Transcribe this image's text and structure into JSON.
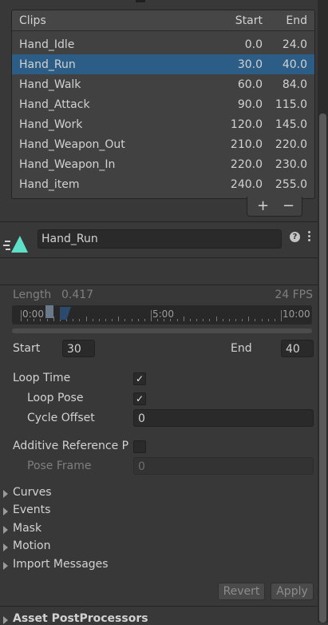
{
  "clips": {
    "header": {
      "name": "Clips",
      "start": "Start",
      "end": "End"
    },
    "rows": [
      {
        "name": "Hand_Idle",
        "start": "0.0",
        "end": "24.0"
      },
      {
        "name": "Hand_Run",
        "start": "30.0",
        "end": "40.0"
      },
      {
        "name": "Hand_Walk",
        "start": "60.0",
        "end": "84.0"
      },
      {
        "name": "Hand_Attack",
        "start": "90.0",
        "end": "115.0"
      },
      {
        "name": "Hand_Work",
        "start": "120.0",
        "end": "145.0"
      },
      {
        "name": "Hand_Weapon_Out",
        "start": "210.0",
        "end": "220.0"
      },
      {
        "name": "Hand_Weapon_In",
        "start": "220.0",
        "end": "230.0"
      },
      {
        "name": "Hand_item",
        "start": "240.0",
        "end": "255.0"
      }
    ],
    "selected_index": 1,
    "add_label": "+",
    "remove_label": "−"
  },
  "clip": {
    "name": "Hand_Run",
    "help_label": "?",
    "icon": "animation-clip-icon",
    "length_label": "Length",
    "length_value": "0.417",
    "fps": "24 FPS"
  },
  "timeline": {
    "labels": [
      "0:00",
      "5:00",
      "10:00"
    ]
  },
  "range": {
    "start_label": "Start",
    "start_value": "30",
    "end_label": "End",
    "end_value": "40"
  },
  "settings": {
    "loop_time_label": "Loop Time",
    "loop_time_checked": true,
    "loop_pose_label": "Loop Pose",
    "loop_pose_checked": true,
    "cycle_offset_label": "Cycle Offset",
    "cycle_offset_value": "0",
    "additive_label": "Additive Reference P",
    "additive_checked": false,
    "pose_frame_label": "Pose Frame",
    "pose_frame_value": "0"
  },
  "foldouts": [
    "Curves",
    "Events",
    "Mask",
    "Motion",
    "Import Messages"
  ],
  "buttons": {
    "revert": "Revert",
    "apply": "Apply"
  },
  "section": {
    "asset_postprocessors": "Asset PostProcessors"
  },
  "colors": {
    "selection": "#2c5d87",
    "background": "#383838",
    "icon_accent": "#5fe0c8"
  }
}
